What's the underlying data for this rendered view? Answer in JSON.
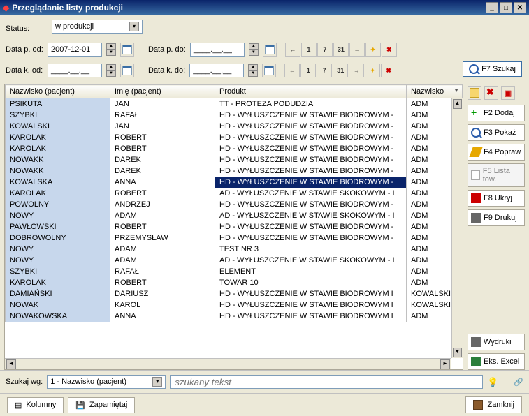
{
  "window": {
    "title": "Przeglądanie listy produkcji"
  },
  "filters": {
    "status_label": "Status:",
    "status_value": "w produkcji",
    "data_p_od_label": "Data p. od:",
    "data_p_od_value": "2007-12-01",
    "data_p_do_label": "Data p. do:",
    "data_p_do_value": "____.__.__",
    "data_k_od_label": "Data k. od:",
    "data_k_od_value": "____.__.__",
    "data_k_do_label": "Data k. do:",
    "data_k_do_value": "____.__.__",
    "nav_icons": [
      "←",
      "1",
      "7",
      "31",
      "→",
      "✦",
      "✖"
    ],
    "f7": "F7 Szukaj"
  },
  "columns": [
    "Nazwisko (pacjent)",
    "Imię (pacjent)",
    "Produkt",
    "Nazwisko"
  ],
  "selected_row": 7,
  "rows": [
    [
      "PSIKUTA",
      "JAN",
      "TT - PROTEZA PODUDZIA",
      "ADM"
    ],
    [
      "SZYBKI",
      "RAFAŁ",
      "HD - WYŁUSZCZENIE W STAWIE BIODROWYM -",
      "ADM"
    ],
    [
      "KOWALSKI",
      "JAN",
      "HD - WYŁUSZCZENIE W STAWIE BIODROWYM -",
      "ADM"
    ],
    [
      "KAROLAK",
      "ROBERT",
      "HD - WYŁUSZCZENIE W STAWIE BIODROWYM -",
      "ADM"
    ],
    [
      "KAROLAK",
      "ROBERT",
      "HD - WYŁUSZCZENIE W STAWIE BIODROWYM -",
      "ADM"
    ],
    [
      "NOWAKK",
      "DAREK",
      "HD - WYŁUSZCZENIE W STAWIE BIODROWYM -",
      "ADM"
    ],
    [
      "NOWAKK",
      "DAREK",
      "HD - WYŁUSZCZENIE W STAWIE BIODROWYM -",
      "ADM"
    ],
    [
      "KOWALSKA",
      "ANNA",
      "HD - WYŁUSZCZENIE W STAWIE BIODROWYM -",
      "ADM"
    ],
    [
      "KAROLAK",
      "ROBERT",
      "AD - WYŁUSZCZENIE W STAWIE SKOKOWYM - I",
      "ADM"
    ],
    [
      "POWOLNY",
      "ANDRZEJ",
      "HD - WYŁUSZCZENIE W STAWIE BIODROWYM -",
      "ADM"
    ],
    [
      "NOWY",
      "ADAM",
      "AD - WYŁUSZCZENIE W STAWIE SKOKOWYM - I",
      "ADM"
    ],
    [
      "PAWŁOWSKI",
      "ROBERT",
      "HD - WYŁUSZCZENIE W STAWIE BIODROWYM -",
      "ADM"
    ],
    [
      "DOBROWOLNY",
      "PRZEMYSŁAW",
      "HD - WYŁUSZCZENIE W STAWIE BIODROWYM -",
      "ADM"
    ],
    [
      "NOWY",
      "ADAM",
      "TEST NR 3",
      "ADM"
    ],
    [
      "NOWY",
      "ADAM",
      "AD - WYŁUSZCZENIE W STAWIE SKOKOWYM - I",
      "ADM"
    ],
    [
      "SZYBKI",
      "RAFAŁ",
      "ELEMENT",
      "ADM"
    ],
    [
      "KAROLAK",
      "ROBERT",
      "TOWAR 10",
      "ADM"
    ],
    [
      "DAMIAŃSKI",
      "DARIUSZ",
      "HD - WYŁUSZCZENIE W STAWIE BIODROWYM I",
      "KOWALSKI"
    ],
    [
      "NOWAK",
      "KAROL",
      "HD - WYŁUSZCZENIE W STAWIE BIODROWYM I",
      "KOWALSKI"
    ],
    [
      "NOWAKOWSKA",
      "ANNA",
      "HD - WYŁUSZCZENIE W STAWIE BIODROWYM I",
      "ADM"
    ]
  ],
  "side": {
    "f2": "F2 Dodaj",
    "f3": "F3 Pokaż",
    "f4": "F4 Popraw",
    "f5": "F5 Lista tow.",
    "f8": "F8 Ukryj",
    "f9": "F9 Drukuj",
    "wydruki": "Wydruki",
    "excel": "Eks. Excel"
  },
  "search": {
    "label": "Szukaj wg:",
    "combo": "1 - Nazwisko (pacjent)",
    "placeholder": "szukany tekst"
  },
  "footer": {
    "kolumny": "Kolumny",
    "zapamietaj": "Zapamiętaj",
    "zamknij": "Zamknij"
  }
}
